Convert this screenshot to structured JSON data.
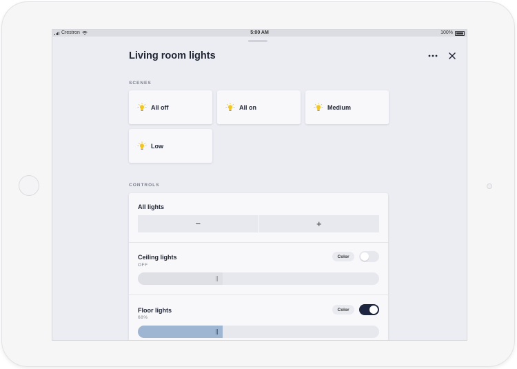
{
  "statusbar": {
    "carrier": "Crestron",
    "time": "5:00 AM",
    "battery": "100%"
  },
  "header": {
    "title": "Living room lights"
  },
  "scenes": {
    "label": "SCENES",
    "items": [
      {
        "label": "All off"
      },
      {
        "label": "All on"
      },
      {
        "label": "Medium"
      },
      {
        "label": "Low"
      }
    ]
  },
  "controls": {
    "label": "CONTROLS",
    "all_lights": {
      "title": "All lights",
      "minus": "−",
      "plus": "+"
    },
    "ceiling": {
      "title": "Ceiling lights",
      "status": "OFF",
      "color_label": "Color",
      "on": false,
      "level_fraction": 0.35
    },
    "floor": {
      "title": "Floor lights",
      "status": "68%",
      "color_label": "Color",
      "on": true,
      "level_fraction": 0.35
    }
  },
  "colors": {
    "accent_dark": "#1d2540",
    "bulb_yellow": "#f3c623",
    "slider_fill_off": "#dfe0e6",
    "slider_fill_on": "#9fb6d3"
  },
  "icons": {
    "bulb": "lightbulb-icon",
    "more": "more-horizontal-icon",
    "close": "close-icon",
    "signal": "signal-bars-icon",
    "wifi": "wifi-icon",
    "battery": "battery-icon"
  }
}
